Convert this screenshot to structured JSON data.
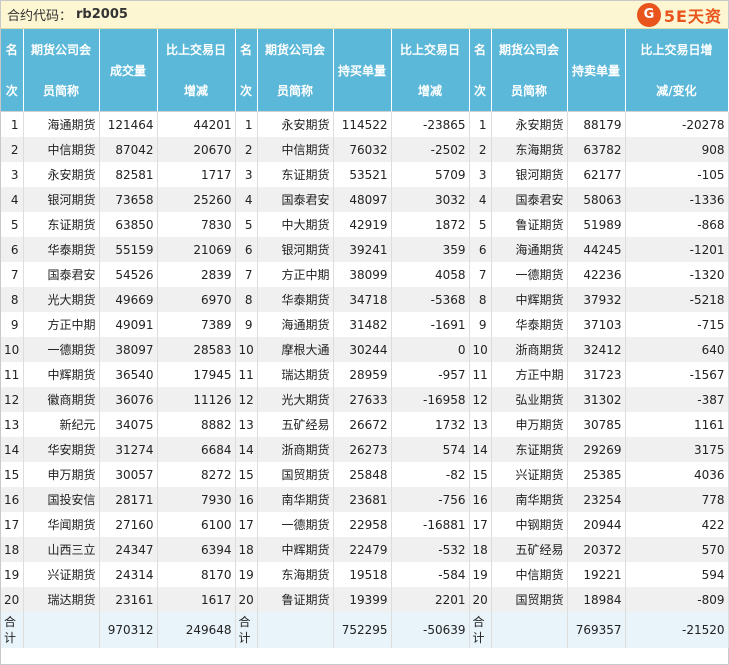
{
  "header": {
    "label": "合约代码：",
    "code": "rb2005",
    "logo_mark": "G",
    "logo_text": "5E天资"
  },
  "columns": [
    {
      "line1": "名",
      "line2": "次"
    },
    {
      "line1": "期货公司会",
      "line2": "员简称"
    },
    {
      "line1": "成交量",
      "line2": ""
    },
    {
      "line1": "比上交易日",
      "line2": "增减"
    },
    {
      "line1": "名",
      "line2": "次"
    },
    {
      "line1": "期货公司会",
      "line2": "员简称"
    },
    {
      "line1": "持买单量",
      "line2": ""
    },
    {
      "line1": "比上交易日",
      "line2": "增减"
    },
    {
      "line1": "名",
      "line2": "次"
    },
    {
      "line1": "期货公司会",
      "line2": "员简称"
    },
    {
      "line1": "持卖单量",
      "line2": ""
    },
    {
      "line1": "比上交易日增",
      "line2": "减/变化"
    }
  ],
  "chart_data": {
    "type": "table",
    "title": "合约代码：rb2005",
    "rows": [
      [
        "1",
        "海通期货",
        "121464",
        "44201",
        "1",
        "永安期货",
        "114522",
        "-23865",
        "1",
        "永安期货",
        "88179",
        "-20278"
      ],
      [
        "2",
        "中信期货",
        "87042",
        "20670",
        "2",
        "中信期货",
        "76032",
        "-2502",
        "2",
        "东海期货",
        "63782",
        "908"
      ],
      [
        "3",
        "永安期货",
        "82581",
        "1717",
        "3",
        "东证期货",
        "53521",
        "5709",
        "3",
        "银河期货",
        "62177",
        "-105"
      ],
      [
        "4",
        "银河期货",
        "73658",
        "25260",
        "4",
        "国泰君安",
        "48097",
        "3032",
        "4",
        "国泰君安",
        "58063",
        "-1336"
      ],
      [
        "5",
        "东证期货",
        "63850",
        "7830",
        "5",
        "中大期货",
        "42919",
        "1872",
        "5",
        "鲁证期货",
        "51989",
        "-868"
      ],
      [
        "6",
        "华泰期货",
        "55159",
        "21069",
        "6",
        "银河期货",
        "39241",
        "359",
        "6",
        "海通期货",
        "44245",
        "-1201"
      ],
      [
        "7",
        "国泰君安",
        "54526",
        "2839",
        "7",
        "方正中期",
        "38099",
        "4058",
        "7",
        "一德期货",
        "42236",
        "-1320"
      ],
      [
        "8",
        "光大期货",
        "49669",
        "6970",
        "8",
        "华泰期货",
        "34718",
        "-5368",
        "8",
        "中辉期货",
        "37932",
        "-5218"
      ],
      [
        "9",
        "方正中期",
        "49091",
        "7389",
        "9",
        "海通期货",
        "31482",
        "-1691",
        "9",
        "华泰期货",
        "37103",
        "-715"
      ],
      [
        "10",
        "一德期货",
        "38097",
        "28583",
        "10",
        "摩根大通",
        "30244",
        "0",
        "10",
        "浙商期货",
        "32412",
        "640"
      ],
      [
        "11",
        "中辉期货",
        "36540",
        "17945",
        "11",
        "瑞达期货",
        "28959",
        "-957",
        "11",
        "方正中期",
        "31723",
        "-1567"
      ],
      [
        "12",
        "徽商期货",
        "36076",
        "11126",
        "12",
        "光大期货",
        "27633",
        "-16958",
        "12",
        "弘业期货",
        "31302",
        "-387"
      ],
      [
        "13",
        "新纪元",
        "34075",
        "8882",
        "13",
        "五矿经易",
        "26672",
        "1732",
        "13",
        "申万期货",
        "30785",
        "1161"
      ],
      [
        "14",
        "华安期货",
        "31274",
        "6684",
        "14",
        "浙商期货",
        "26273",
        "574",
        "14",
        "东证期货",
        "29269",
        "3175"
      ],
      [
        "15",
        "申万期货",
        "30057",
        "8272",
        "15",
        "国贸期货",
        "25848",
        "-82",
        "15",
        "兴证期货",
        "25385",
        "4036"
      ],
      [
        "16",
        "国投安信",
        "28171",
        "7930",
        "16",
        "南华期货",
        "23681",
        "-756",
        "16",
        "南华期货",
        "23254",
        "778"
      ],
      [
        "17",
        "华闻期货",
        "27160",
        "6100",
        "17",
        "一德期货",
        "22958",
        "-16881",
        "17",
        "中钢期货",
        "20944",
        "422"
      ],
      [
        "18",
        "山西三立",
        "24347",
        "6394",
        "18",
        "中辉期货",
        "22479",
        "-532",
        "18",
        "五矿经易",
        "20372",
        "570"
      ],
      [
        "19",
        "兴证期货",
        "24314",
        "8170",
        "19",
        "东海期货",
        "19518",
        "-584",
        "19",
        "中信期货",
        "19221",
        "594"
      ],
      [
        "20",
        "瑞达期货",
        "23161",
        "1617",
        "20",
        "鲁证期货",
        "19399",
        "2201",
        "20",
        "国贸期货",
        "18984",
        "-809"
      ]
    ],
    "totals": {
      "label": "合计",
      "volume": "970312",
      "volume_change": "249648",
      "long": "752295",
      "long_change": "-50639",
      "short": "769357",
      "short_change": "-21520"
    }
  }
}
